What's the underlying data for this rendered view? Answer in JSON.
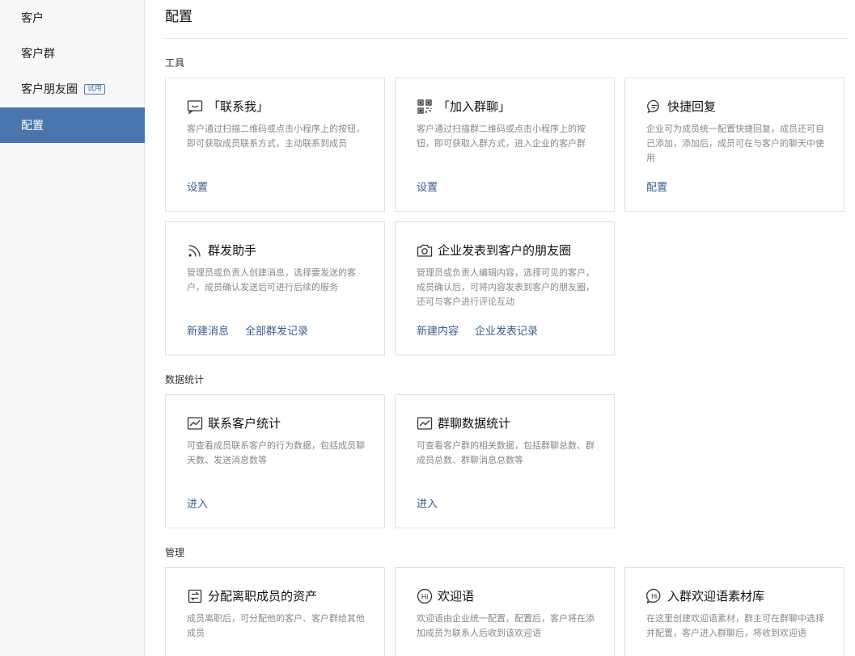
{
  "sidebar": {
    "items": [
      {
        "label": "客户"
      },
      {
        "label": "客户群"
      },
      {
        "label": "客户朋友圈",
        "badge": "试用"
      },
      {
        "label": "配置",
        "active": true
      }
    ]
  },
  "page": {
    "title": "配置"
  },
  "sections": {
    "tools": {
      "title": "工具",
      "cards": [
        {
          "icon": "message-square-icon",
          "title": "「联系我」",
          "desc": "客户通过扫描二维码或点击小程序上的按钮，即可获取成员联系方式，主动联系到成员",
          "links": [
            "设置"
          ]
        },
        {
          "icon": "qr-code-icon",
          "title": "「加入群聊」",
          "desc": "客户通过扫描群二维码或点击小程序上的按钮，即可获取入群方式，进入企业的客户群",
          "links": [
            "设置"
          ]
        },
        {
          "icon": "chat-bubble-icon",
          "title": "快捷回复",
          "desc": "企业可为成员统一配置快捷回复，成员还可自己添加，添加后，成员可在与客户的聊天中使用",
          "links": [
            "配置"
          ]
        },
        {
          "icon": "broadcast-icon",
          "title": "群发助手",
          "desc": "管理员或负责人创建消息，选择要发送的客户，成员确认发送后可进行后续的服务",
          "links": [
            "新建消息",
            "全部群发记录"
          ]
        },
        {
          "icon": "camera-icon",
          "title": "企业发表到客户的朋友圈",
          "desc": "管理员或负责人编辑内容，选择可见的客户，成员确认后，可将内容发表到客户的朋友圈，还可与客户进行评论互动",
          "links": [
            "新建内容",
            "企业发表记录"
          ]
        }
      ]
    },
    "stats": {
      "title": "数据统计",
      "cards": [
        {
          "icon": "line-chart-icon",
          "title": "联系客户统计",
          "desc": "可查看成员联系客户的行为数据，包括成员聊天数、发送消息数等",
          "links": [
            "进入"
          ]
        },
        {
          "icon": "line-chart-icon",
          "title": "群聊数据统计",
          "desc": "可查看客户群的相关数据，包括群聊总数、群成员总数、群聊消息总数等",
          "links": [
            "进入"
          ]
        }
      ]
    },
    "manage": {
      "title": "管理",
      "cards": [
        {
          "icon": "transfer-icon",
          "title": "分配离职成员的资产",
          "desc": "成员离职后，可分配他的客户、客户群给其他成员",
          "links": []
        },
        {
          "icon": "hi-icon",
          "title": "欢迎语",
          "desc": "欢迎语由企业统一配置，配置后，客户将在添加成员为联系人后收到该欢迎语",
          "links": []
        },
        {
          "icon": "hi-chat-icon",
          "title": "入群欢迎语素材库",
          "desc": "在这里创建欢迎语素材，群主可在群聊中选择并配置，客户进入群聊后，将收到欢迎语",
          "links": []
        }
      ]
    }
  }
}
